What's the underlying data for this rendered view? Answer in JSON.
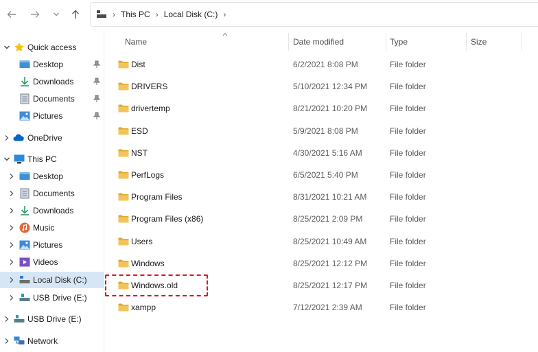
{
  "breadcrumb": [
    "This PC",
    "Local Disk (C:)"
  ],
  "colors": {
    "folder": "#f2c55c",
    "folder_dark": "#e0a82e",
    "selected": "#d6e6f5",
    "highlight": "#d9161e",
    "star": "#f5c400",
    "onedrive": "#0a64c8"
  },
  "sidebar": {
    "quick_access": "Quick access",
    "quick_items": [
      "Desktop",
      "Downloads",
      "Documents",
      "Pictures"
    ],
    "onedrive": "OneDrive",
    "this_pc": "This PC",
    "pc_items": [
      "Desktop",
      "Documents",
      "Downloads",
      "Music",
      "Pictures",
      "Videos",
      "Local Disk (C:)",
      "USB Drive (E:)"
    ],
    "usb_drive": "USB Drive (E:)",
    "network": "Network"
  },
  "columns": {
    "name": "Name",
    "date": "Date modified",
    "type": "Type",
    "size": "Size"
  },
  "rows": [
    {
      "name": "Dist",
      "date": "6/2/2021 8:08 PM",
      "type": "File folder"
    },
    {
      "name": "DRIVERS",
      "date": "5/10/2021 12:34 PM",
      "type": "File folder"
    },
    {
      "name": "drivertemp",
      "date": "8/21/2021 10:20 PM",
      "type": "File folder"
    },
    {
      "name": "ESD",
      "date": "5/9/2021 8:08 PM",
      "type": "File folder"
    },
    {
      "name": "NST",
      "date": "4/30/2021 5:16 AM",
      "type": "File folder"
    },
    {
      "name": "PerfLogs",
      "date": "6/5/2021 5:40 PM",
      "type": "File folder"
    },
    {
      "name": "Program Files",
      "date": "8/31/2021 10:21 AM",
      "type": "File folder"
    },
    {
      "name": "Program Files (x86)",
      "date": "8/25/2021 2:09 PM",
      "type": "File folder"
    },
    {
      "name": "Users",
      "date": "8/25/2021 10:49 AM",
      "type": "File folder"
    },
    {
      "name": "Windows",
      "date": "8/25/2021 12:12 PM",
      "type": "File folder"
    },
    {
      "name": "Windows.old",
      "date": "8/25/2021 12:17 PM",
      "type": "File folder"
    },
    {
      "name": "xampp",
      "date": "7/12/2021 2:39 AM",
      "type": "File folder"
    }
  ]
}
